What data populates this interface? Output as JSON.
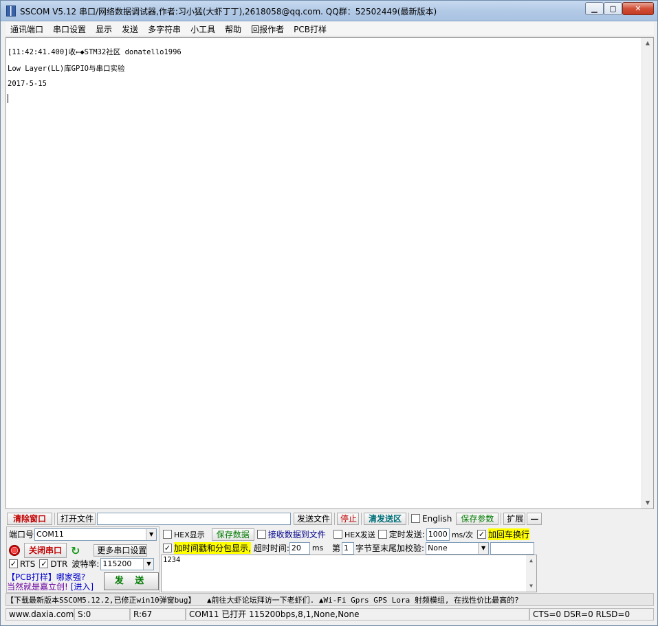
{
  "window": {
    "title": "SSCOM V5.12 串口/网络数据调试器,作者:习小猛(大虾丁丁),2618058@qq.com. QQ群：52502449(最新版本)",
    "minimize": "▁",
    "maximize": "▢",
    "close": "✕"
  },
  "menu": [
    "通讯端口",
    "串口设置",
    "显示",
    "发送",
    "多字符串",
    "小工具",
    "帮助",
    "回报作者",
    "PCB打样"
  ],
  "terminal": {
    "lines": [
      "[11:42:41.400]收←◆STM32社区 donatello1996",
      "Low Layer(LL)库GPIO与串口实验",
      "2017-5-15"
    ]
  },
  "toolbar": {
    "clear_window": "清除窗口",
    "open_file": "打开文件",
    "file_path": "",
    "send_file": "发送文件",
    "stop": "停止",
    "clear_send": "清发送区",
    "english_label": "English",
    "english_checked": false,
    "save_params": "保存参数",
    "expand": "扩展",
    "collapse": "—"
  },
  "port": {
    "port_label": "端口号",
    "port_value": "COM11",
    "close_port": "关闭串口",
    "more_settings": "更多串口设置",
    "rts_label": "RTS",
    "rts_checked": true,
    "dtr_label": "DTR",
    "dtr_checked": true,
    "baud_label": "波特率:",
    "baud_value": "115200"
  },
  "display_opts": {
    "hex_display": "HEX显示",
    "hex_display_checked": false,
    "save_data": "保存数据",
    "recv_to_file": "接收数据到文件",
    "recv_to_file_checked": false,
    "timestamp": "加时间戳和分包显示,",
    "timestamp_checked": true,
    "timeout_label": "超时时间:",
    "timeout_value": "20",
    "timeout_unit": "ms"
  },
  "send_opts": {
    "hex_send": "HEX发送",
    "hex_send_checked": false,
    "timed_send": "定时发送:",
    "timed_send_checked": false,
    "interval_value": "1000",
    "interval_unit": "ms/次",
    "add_crlf": "加回车换行",
    "add_crlf_checked": true,
    "byte_prefix": "第",
    "byte_value": "1",
    "byte_suffix": "字节至末尾加校验:",
    "checksum_value": "None"
  },
  "ads": {
    "pcb_line1": "【PCB打样】哪家强?",
    "pcb_line2": "当然就是嘉立创!",
    "enter": "[进入]"
  },
  "send": {
    "text": "1234",
    "button": "发 送"
  },
  "notice": "【下载最新版本SSCOM5.12.2,已修正win10弹窗bug】　　▲前往大虾论坛拜访一下老虾们. ▲Wi-Fi Gprs GPS Lora 射频模组, 在找性价比最高的?",
  "status": {
    "site": "www.daxia.com",
    "sent": "S:0",
    "received": "R:67",
    "port_state": "COM11 已打开  115200bps,8,1,None,None",
    "signals": "CTS=0 DSR=0 RLSD=0"
  },
  "colors": {
    "red_button": "#c00000",
    "green_button": "#007a00",
    "highlight": "#ffff00"
  }
}
